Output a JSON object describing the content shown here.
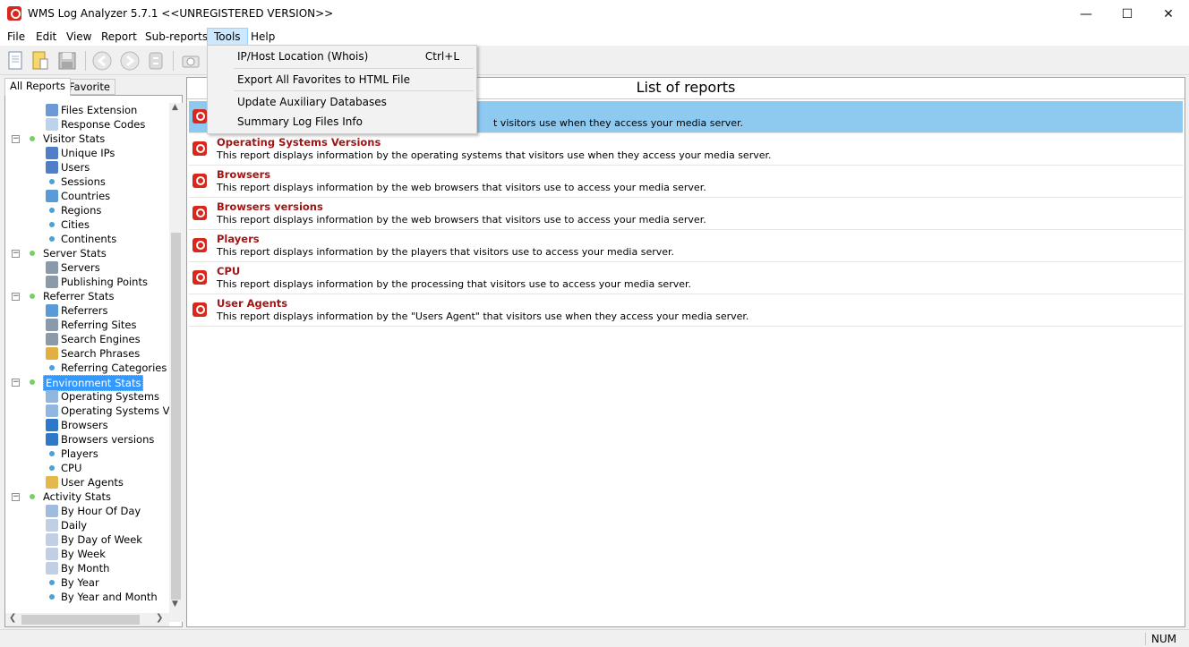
{
  "window": {
    "title": "WMS Log Analyzer 5.7.1 <<UNREGISTERED VERSION>>",
    "controls": {
      "minimize": "—",
      "maximize": "☐",
      "close": "✕"
    }
  },
  "menubar": [
    "File",
    "Edit",
    "View",
    "Report",
    "Sub-reports",
    "Tools",
    "Help"
  ],
  "tools_menu": {
    "items": [
      {
        "label": "IP/Host Location (Whois)",
        "shortcut": "Ctrl+L"
      },
      {
        "label": "Export All Favorites to HTML File",
        "shortcut": ""
      },
      {
        "label": "Update Auxiliary Databases",
        "shortcut": ""
      },
      {
        "label": "Summary Log Files Info",
        "shortcut": ""
      }
    ]
  },
  "left_tabs": {
    "all": "All Reports",
    "favorite": "Favorite"
  },
  "tree": [
    {
      "label": "Files Extension",
      "level": 2,
      "icon": "table-icon"
    },
    {
      "label": "Response Codes",
      "level": 2,
      "icon": "chat-icon"
    },
    {
      "label": "Visitor Stats",
      "level": 1
    },
    {
      "label": "Unique IPs",
      "level": 2,
      "icon": "person-icon"
    },
    {
      "label": "Users",
      "level": 2,
      "icon": "person-icon"
    },
    {
      "label": "Sessions",
      "level": 2,
      "icon": "dot"
    },
    {
      "label": "Countries",
      "level": 2,
      "icon": "globe-icon"
    },
    {
      "label": "Regions",
      "level": 2,
      "icon": "dot"
    },
    {
      "label": "Cities",
      "level": 2,
      "icon": "dot"
    },
    {
      "label": "Continents",
      "level": 2,
      "icon": "dot"
    },
    {
      "label": "Server Stats",
      "level": 1
    },
    {
      "label": "Servers",
      "level": 2,
      "icon": "server-icon"
    },
    {
      "label": "Publishing Points",
      "level": 2,
      "icon": "server-icon"
    },
    {
      "label": "Referrer Stats",
      "level": 1
    },
    {
      "label": "Referrers",
      "level": 2,
      "icon": "globe-icon"
    },
    {
      "label": "Referring Sites",
      "level": 2,
      "icon": "server-icon"
    },
    {
      "label": "Search Engines",
      "level": 2,
      "icon": "server-icon"
    },
    {
      "label": "Search Phrases",
      "level": 2,
      "icon": "magnifier-icon"
    },
    {
      "label": "Referring Categories",
      "level": 2,
      "icon": "dot"
    },
    {
      "label": "Environment Stats",
      "level": 1,
      "selected": true
    },
    {
      "label": "Operating Systems",
      "level": 2,
      "icon": "disc-icon"
    },
    {
      "label": "Operating Systems Versic",
      "level": 2,
      "icon": "disc-icon"
    },
    {
      "label": "Browsers",
      "level": 2,
      "icon": "ie-icon"
    },
    {
      "label": "Browsers versions",
      "level": 2,
      "icon": "ie-icon"
    },
    {
      "label": "Players",
      "level": 2,
      "icon": "dot"
    },
    {
      "label": "CPU",
      "level": 2,
      "icon": "dot"
    },
    {
      "label": "User Agents",
      "level": 2,
      "icon": "agent-icon"
    },
    {
      "label": "Activity Stats",
      "level": 1
    },
    {
      "label": "By Hour Of Day",
      "level": 2,
      "icon": "clock-icon"
    },
    {
      "label": "Daily",
      "level": 2,
      "icon": "calendar-icon"
    },
    {
      "label": "By Day of Week",
      "level": 2,
      "icon": "calendar-icon"
    },
    {
      "label": "By Week",
      "level": 2,
      "icon": "calendar-icon"
    },
    {
      "label": "By Month",
      "level": 2,
      "icon": "calendar-icon"
    },
    {
      "label": "By Year",
      "level": 2,
      "icon": "dot"
    },
    {
      "label": "By Year and Month",
      "level": 2,
      "icon": "dot"
    }
  ],
  "reports": {
    "header": "List of reports",
    "rows": [
      {
        "title": "",
        "desc": "t visitors use when they access your media server.",
        "selected": true
      },
      {
        "title": "Operating Systems Versions",
        "desc": "This report displays information by the operating systems that visitors use when they access your media server."
      },
      {
        "title": "Browsers",
        "desc": "This report displays information by the web browsers that visitors use to access your media server."
      },
      {
        "title": "Browsers versions",
        "desc": "This report displays information by the web browsers that visitors use to access your media server."
      },
      {
        "title": "Players",
        "desc": "This report displays information by the players that visitors use to access your media server."
      },
      {
        "title": "CPU",
        "desc": "This report displays information by the processing that visitors use to access your media server."
      },
      {
        "title": "User Agents",
        "desc": "This report displays information by the \"Users Agent\" that visitors use when they access your media server."
      }
    ]
  },
  "statusbar": {
    "num": "NUM"
  },
  "colors": {
    "accent": "#d9271e",
    "selection": "#8ec9f0",
    "tree_selection": "#3399ff",
    "report_title": "#a31515"
  }
}
